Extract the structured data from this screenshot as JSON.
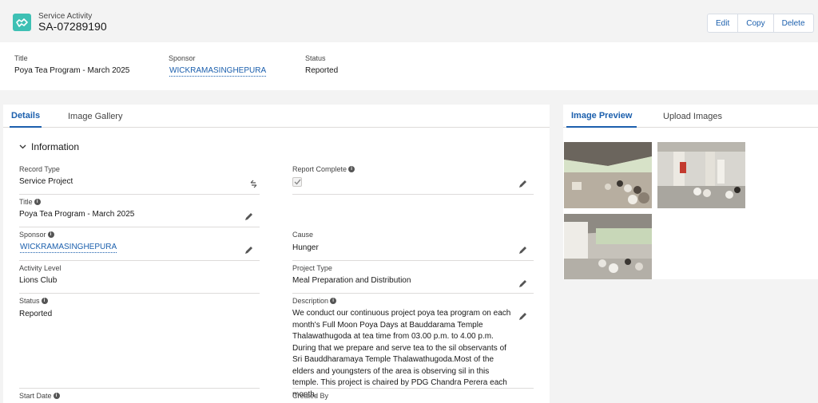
{
  "header": {
    "object_label": "Service Activity",
    "record_name": "SA-07289190",
    "actions": {
      "edit": "Edit",
      "copy": "Copy",
      "delete": "Delete"
    }
  },
  "highlights": {
    "title_label": "Title",
    "title_value": "Poya Tea Program - March 2025",
    "sponsor_label": "Sponsor",
    "sponsor_value": "WICKRAMASINGHEPURA",
    "status_label": "Status",
    "status_value": "Reported"
  },
  "left_tabs": {
    "details": "Details",
    "gallery": "Image Gallery"
  },
  "right_tabs": {
    "preview": "Image Preview",
    "upload": "Upload Images"
  },
  "section": {
    "title": "Information"
  },
  "fields": {
    "record_type": {
      "label": "Record Type",
      "value": "Service Project"
    },
    "report_complete": {
      "label": "Report Complete",
      "checked": true
    },
    "title": {
      "label": "Title",
      "value": "Poya Tea Program - March 2025"
    },
    "sponsor": {
      "label": "Sponsor",
      "value": "WICKRAMASINGHEPURA"
    },
    "cause": {
      "label": "Cause",
      "value": "Hunger"
    },
    "activity_level": {
      "label": "Activity Level",
      "value": "Lions Club"
    },
    "project_type": {
      "label": "Project Type",
      "value": "Meal Preparation and Distribution"
    },
    "status": {
      "label": "Status",
      "value": "Reported"
    },
    "description": {
      "label": "Description",
      "value": "We conduct our continuous project poya tea program on each month's Full Moon Poya Days at Bauddarama Temple Thalawathugoda at tea time from 03.00 p.m. to 4.00 p.m. During that we prepare and serve tea to the sil observants of Sri Bauddharamaya Temple Thalawathugoda.Most of the elders and youngsters of the area is observing sil in this temple. This project is chaired by PDG Chandra Perera each month."
    },
    "start_date": {
      "label": "Start Date"
    },
    "created_by": {
      "label": "Created By"
    }
  },
  "colors": {
    "accent": "#1b5fad",
    "icon_bg": "#3ec0b4",
    "page_bg": "#f3f3f3"
  }
}
